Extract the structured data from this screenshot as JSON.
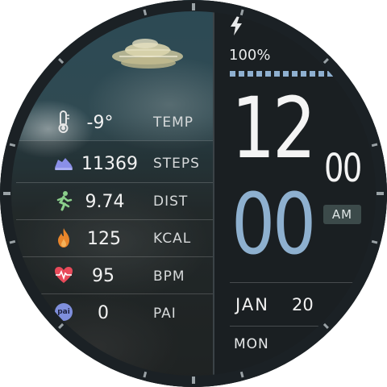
{
  "battery": {
    "percent_label": "100%",
    "level": 1.0,
    "icon": "lightning-bolt-icon"
  },
  "time": {
    "hour": "12",
    "minute": "00",
    "second": "00",
    "period": "AM"
  },
  "date": {
    "month": "JAN",
    "day": "20",
    "weekday": "MON"
  },
  "stats": [
    {
      "icon": "thermometer-icon",
      "value": "-9°",
      "label": "TEMP"
    },
    {
      "icon": "shoe-icon",
      "value": "11369",
      "label": "STEPS"
    },
    {
      "icon": "running-person-icon",
      "value": "9.74",
      "label": "DIST"
    },
    {
      "icon": "flame-icon",
      "value": "125",
      "label": "KCAL"
    },
    {
      "icon": "heart-pulse-icon",
      "value": "95",
      "label": "BPM"
    },
    {
      "icon": "pai-icon",
      "icon_text": "pai",
      "value": "0",
      "label": "PAI"
    }
  ],
  "colors": {
    "accent_blue": "#8eb0cf",
    "steps_purple": "#8a8fe8",
    "dist_green": "#8bcf8b",
    "kcal_orange": "#e8852b",
    "bpm_red": "#e84a5a",
    "pai_purple": "#7f8fdc"
  }
}
